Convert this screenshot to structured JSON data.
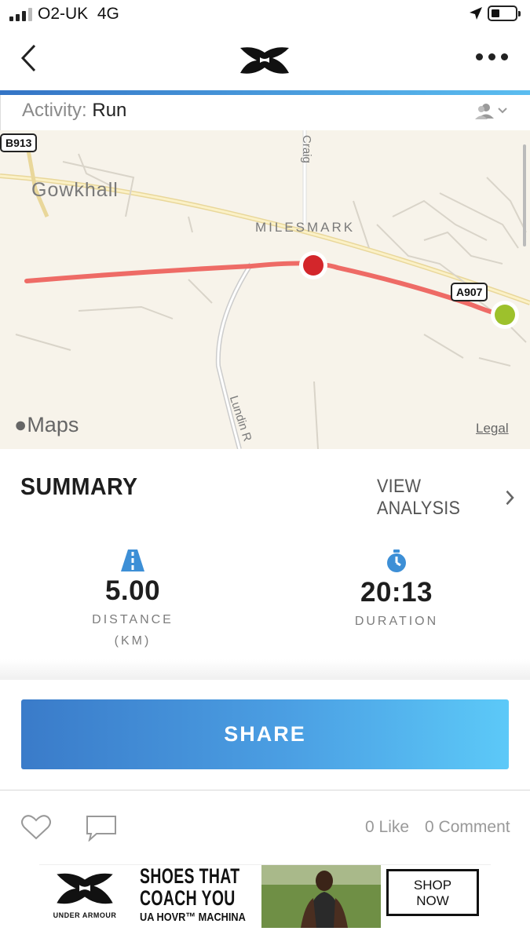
{
  "status_bar": {
    "carrier": "O2-UK",
    "network": "4G"
  },
  "nav": {
    "back_icon": "chevron-left-icon",
    "logo": "under-armour-logo",
    "more_icon": "more-dots-icon"
  },
  "activity": {
    "label": "Activity:",
    "value": "Run"
  },
  "map": {
    "labels": {
      "town1": "Gowkhall",
      "town2": "MILESMARK",
      "road1": "Craig",
      "road2": "Lundin R"
    },
    "road_badges": {
      "b1": "B913",
      "b2": "A907"
    },
    "brand": "Maps",
    "legal": "Legal",
    "route_color": "#ee6b66",
    "start_color": "#9dc12c",
    "end_color": "#d3262b"
  },
  "summary": {
    "title": "SUMMARY",
    "view_analysis": "VIEW ANALYSIS",
    "distance": {
      "value": "5.00",
      "label": "DISTANCE",
      "unit": "(KM)"
    },
    "duration": {
      "value": "20:13",
      "label": "DURATION"
    }
  },
  "share": {
    "label": "SHARE"
  },
  "social": {
    "likes": "0 Like",
    "comments": "0 Comment"
  },
  "ad": {
    "brand": "UNDER ARMOUR",
    "headline1": "SHOES THAT",
    "headline2": "COACH YOU",
    "headline3": "UA HOVR™ MACHINA",
    "cta_line1": "SHOP",
    "cta_line2": "NOW"
  }
}
